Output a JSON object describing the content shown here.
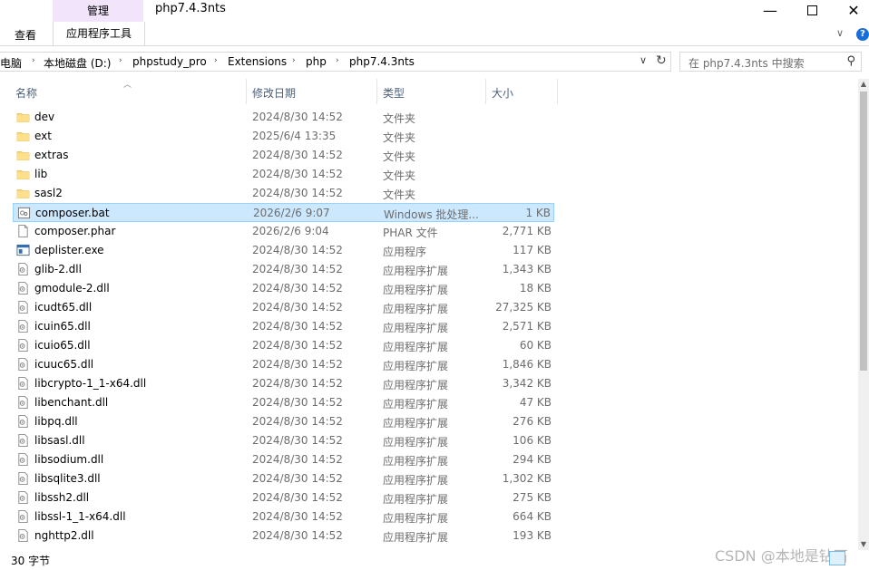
{
  "window": {
    "title": "php7.4.3nts",
    "context_tab_group": "管理",
    "minimize": "—",
    "close": "✕"
  },
  "ribbon": {
    "tab_view": "查看",
    "tab_app_tools": "应用程序工具"
  },
  "address": {
    "crumbs": [
      "电脑",
      "本地磁盘 (D:)",
      "phpstudy_pro",
      "Extensions",
      "php",
      "php7.4.3nts"
    ]
  },
  "search": {
    "placeholder": "在 php7.4.3nts 中搜索"
  },
  "columns": {
    "name": "名称",
    "date": "修改日期",
    "type": "类型",
    "size": "大小"
  },
  "files": [
    {
      "name": "dev",
      "date": "2024/8/30 14:52",
      "type": "文件夹",
      "size": "",
      "icon": "folder-icon"
    },
    {
      "name": "ext",
      "date": "2025/6/4 13:35",
      "type": "文件夹",
      "size": "",
      "icon": "folder-icon"
    },
    {
      "name": "extras",
      "date": "2024/8/30 14:52",
      "type": "文件夹",
      "size": "",
      "icon": "folder-icon"
    },
    {
      "name": "lib",
      "date": "2024/8/30 14:52",
      "type": "文件夹",
      "size": "",
      "icon": "folder-icon"
    },
    {
      "name": "sasl2",
      "date": "2024/8/30 14:52",
      "type": "文件夹",
      "size": "",
      "icon": "folder-icon"
    },
    {
      "name": "composer.bat",
      "date": "2026/2/6 9:07",
      "type": "Windows 批处理...",
      "size": "1 KB",
      "icon": "batch-file-icon",
      "selected": true
    },
    {
      "name": "composer.phar",
      "date": "2026/2/6 9:04",
      "type": "PHAR 文件",
      "size": "2,771 KB",
      "icon": "file-icon"
    },
    {
      "name": "deplister.exe",
      "date": "2024/8/30 14:52",
      "type": "应用程序",
      "size": "117 KB",
      "icon": "exe-icon"
    },
    {
      "name": "glib-2.dll",
      "date": "2024/8/30 14:52",
      "type": "应用程序扩展",
      "size": "1,343 KB",
      "icon": "dll-icon"
    },
    {
      "name": "gmodule-2.dll",
      "date": "2024/8/30 14:52",
      "type": "应用程序扩展",
      "size": "18 KB",
      "icon": "dll-icon"
    },
    {
      "name": "icudt65.dll",
      "date": "2024/8/30 14:52",
      "type": "应用程序扩展",
      "size": "27,325 KB",
      "icon": "dll-icon"
    },
    {
      "name": "icuin65.dll",
      "date": "2024/8/30 14:52",
      "type": "应用程序扩展",
      "size": "2,571 KB",
      "icon": "dll-icon"
    },
    {
      "name": "icuio65.dll",
      "date": "2024/8/30 14:52",
      "type": "应用程序扩展",
      "size": "60 KB",
      "icon": "dll-icon"
    },
    {
      "name": "icuuc65.dll",
      "date": "2024/8/30 14:52",
      "type": "应用程序扩展",
      "size": "1,846 KB",
      "icon": "dll-icon"
    },
    {
      "name": "libcrypto-1_1-x64.dll",
      "date": "2024/8/30 14:52",
      "type": "应用程序扩展",
      "size": "3,342 KB",
      "icon": "dll-icon"
    },
    {
      "name": "libenchant.dll",
      "date": "2024/8/30 14:52",
      "type": "应用程序扩展",
      "size": "47 KB",
      "icon": "dll-icon"
    },
    {
      "name": "libpq.dll",
      "date": "2024/8/30 14:52",
      "type": "应用程序扩展",
      "size": "276 KB",
      "icon": "dll-icon"
    },
    {
      "name": "libsasl.dll",
      "date": "2024/8/30 14:52",
      "type": "应用程序扩展",
      "size": "106 KB",
      "icon": "dll-icon"
    },
    {
      "name": "libsodium.dll",
      "date": "2024/8/30 14:52",
      "type": "应用程序扩展",
      "size": "294 KB",
      "icon": "dll-icon"
    },
    {
      "name": "libsqlite3.dll",
      "date": "2024/8/30 14:52",
      "type": "应用程序扩展",
      "size": "1,302 KB",
      "icon": "dll-icon"
    },
    {
      "name": "libssh2.dll",
      "date": "2024/8/30 14:52",
      "type": "应用程序扩展",
      "size": "275 KB",
      "icon": "dll-icon"
    },
    {
      "name": "libssl-1_1-x64.dll",
      "date": "2024/8/30 14:52",
      "type": "应用程序扩展",
      "size": "664 KB",
      "icon": "dll-icon"
    },
    {
      "name": "nghttp2.dll",
      "date": "2024/8/30 14:52",
      "type": "应用程序扩展",
      "size": "193 KB",
      "icon": "dll-icon"
    }
  ],
  "status": {
    "count": "30 字节"
  },
  "watermark": "CSDN @本地是钻石",
  "colors": {
    "selection_bg": "#cce8ff",
    "selection_border": "#99d1ff",
    "context_tab": "#f1e4fb",
    "folder": "#f8d775",
    "header_text": "#4c607a"
  }
}
